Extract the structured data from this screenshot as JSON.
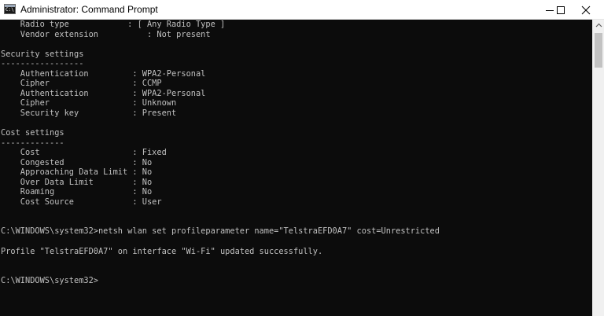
{
  "window": {
    "title": "Administrator: Command Prompt",
    "app_icon_glyph": "C:\\"
  },
  "icons": {
    "app": "command-prompt-icon",
    "minimize": "minimize-icon",
    "maximize": "maximize-icon",
    "close": "close-icon",
    "scroll_up": "chevron-up-icon"
  },
  "colors": {
    "console_background": "#0c0c0c",
    "console_text": "#c0c0c0",
    "titlebar_background": "#ffffff",
    "scrollbar_track": "#f0f0f0",
    "scrollbar_thumb": "#c2c2c2"
  },
  "console": {
    "lines": [
      "    Radio type            : [ Any Radio Type ]",
      "    Vendor extension          : Not present",
      "",
      "Security settings",
      "-----------------",
      "    Authentication         : WPA2-Personal",
      "    Cipher                 : CCMP",
      "    Authentication         : WPA2-Personal",
      "    Cipher                 : Unknown",
      "    Security key           : Present",
      "",
      "Cost settings",
      "-------------",
      "    Cost                   : Fixed",
      "    Congested              : No",
      "    Approaching Data Limit : No",
      "    Over Data Limit        : No",
      "    Roaming                : No",
      "    Cost Source            : User",
      "",
      "",
      "C:\\WINDOWS\\system32>netsh wlan set profileparameter name=\"TelstraEFD0A7\" cost=Unrestricted",
      "",
      "Profile \"TelstraEFD0A7\" on interface \"Wi-Fi\" updated successfully.",
      "",
      "",
      "C:\\WINDOWS\\system32>"
    ]
  }
}
